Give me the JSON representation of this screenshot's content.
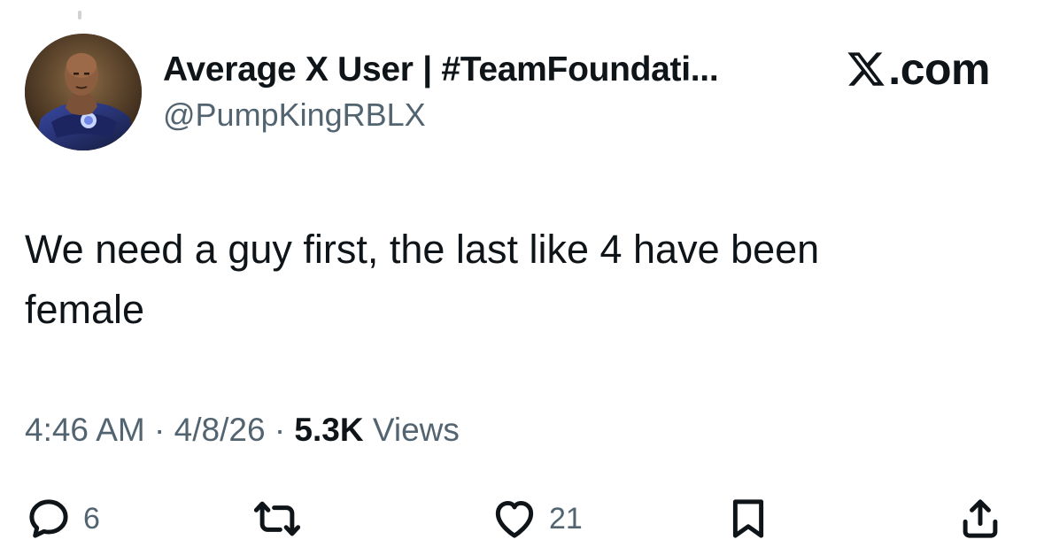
{
  "tweet": {
    "display_name": "Average X User | #TeamFoundati...",
    "handle": "@PumpKingRBLX",
    "brand": ".com",
    "text_line1": "We need a guy first, the last like 4 have been",
    "text_line2": "female",
    "time": "4:46 AM",
    "separator": "·",
    "date": "4/8/26",
    "views_count": "5.3K",
    "views_label": "Views"
  },
  "actions": {
    "reply_count": "6",
    "repost_count": "",
    "like_count": "21"
  },
  "icons": {
    "avatar": "avatar",
    "brand_logo": "x-logo-icon",
    "reply": "reply-icon",
    "repost": "repost-icon",
    "like": "heart-icon",
    "bookmark": "bookmark-icon",
    "share": "share-icon"
  },
  "colors": {
    "text_primary": "#0f1419",
    "text_secondary": "#536471",
    "background": "#ffffff"
  }
}
